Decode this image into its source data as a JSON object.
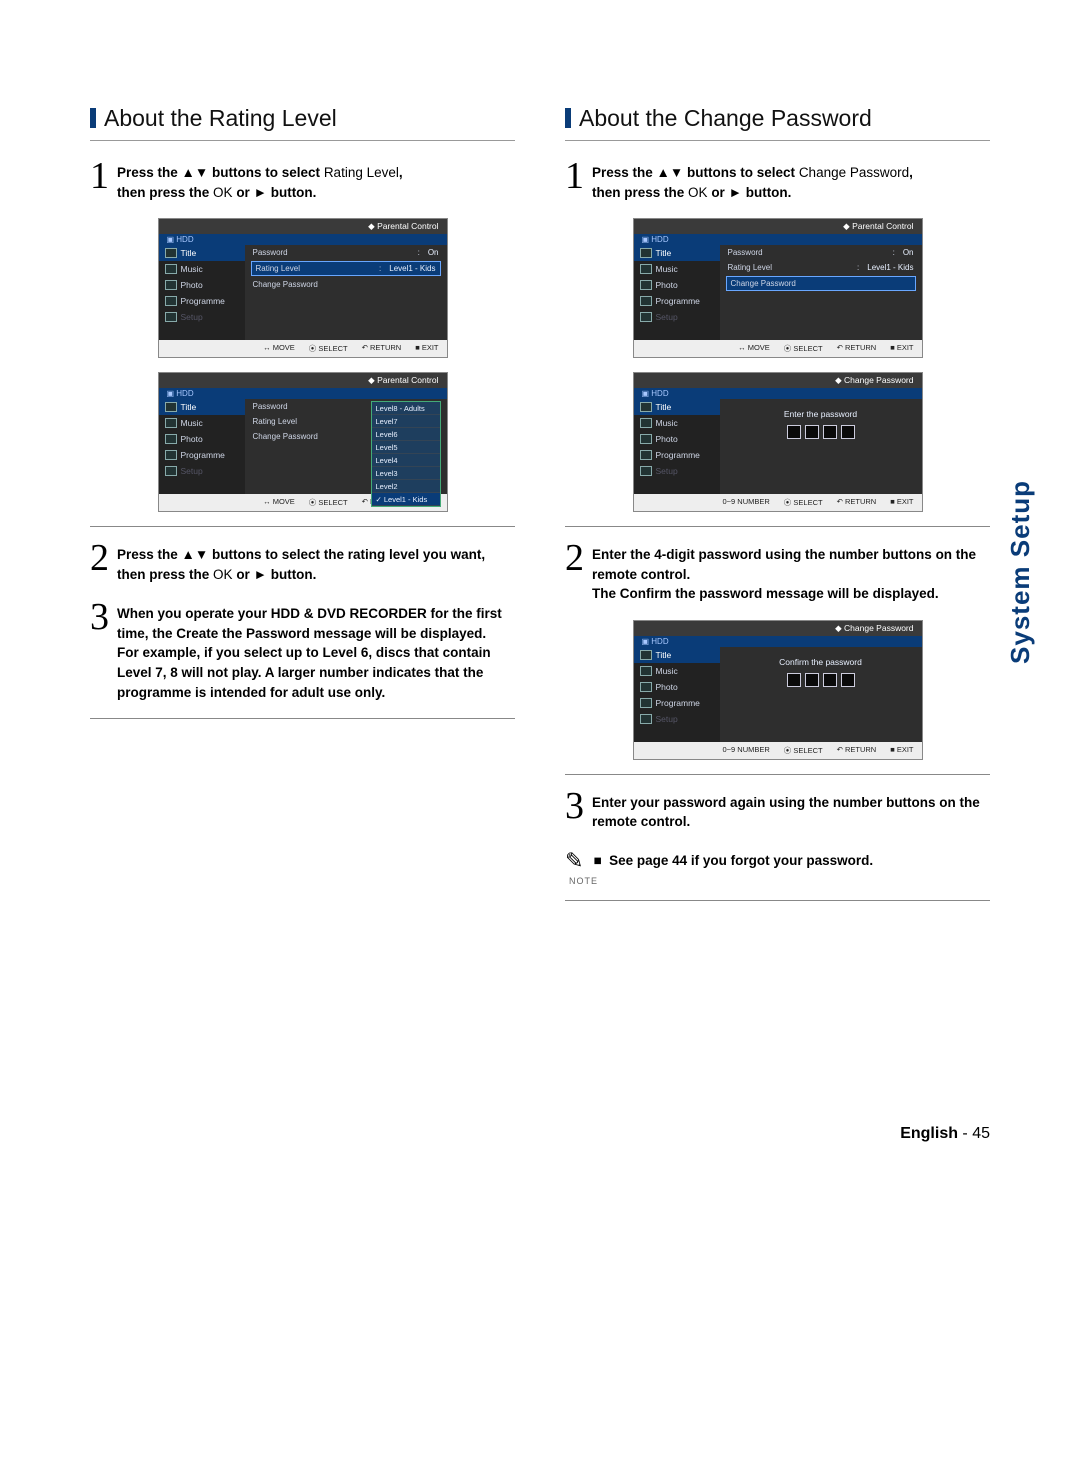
{
  "page": {
    "lang": "English",
    "num": "45",
    "vertical_label": "System Setup"
  },
  "left": {
    "title": "About the Rating Level",
    "step1": {
      "num": "1",
      "t1": "Press the ",
      "t2": " buttons to select",
      "target": "Rating Level",
      "t3": ",",
      "t4": "then press the",
      "ok": "OK",
      "t5": " or ",
      "t6": " button."
    },
    "step2": {
      "num": "2",
      "t1": "Press the ",
      "t2": " buttons to select the rating level you want, then press the",
      "ok": "OK",
      "t3": " or ",
      "t4": " button."
    },
    "step3": {
      "num": "3",
      "body": "When you operate your HDD & DVD RECORDER for the first time, the Create the Password message will be displayed.\nFor example, if you select up to Level 6, discs that contain Level 7, 8 will not play. A larger number indicates that the programme is intended for adult use only."
    }
  },
  "right": {
    "title": "About the Change Password",
    "step1": {
      "num": "1",
      "t1": "Press the ",
      "t2": " buttons to select",
      "target": "Change Password",
      "t3": ",",
      "t4": "then press the",
      "ok": "OK",
      "t5": " or ",
      "t6": " button."
    },
    "step2": {
      "num": "2",
      "t1": "Enter the 4-digit",
      "t2": "password using the number buttons",
      "t3": "on the remote control.",
      "t4": "The Confirm the password message will be displayed."
    },
    "step3": {
      "num": "3",
      "t1": "Enter",
      "t2": "your password again using the number buttons on the",
      "t3": "remote control."
    },
    "note": "See page 44 if you forgot your password.",
    "note_label": "NOTE"
  },
  "osd": {
    "nav": [
      "Title",
      "Music",
      "Photo",
      "Programme",
      "Setup"
    ],
    "hdd": "HDD",
    "pc": "Parental Control",
    "cp": "Change Password",
    "rows": {
      "password": "Password",
      "on": "On",
      "rating": "Rating Level",
      "rl_val": "Level1 - Kids",
      "changepw": "Change Password"
    },
    "levels": [
      "Level8 - Adults",
      "Level7",
      "Level6",
      "Level5",
      "Level4",
      "Level3",
      "Level2",
      "Level1 - Kids"
    ],
    "enter": "Enter the password",
    "confirm": "Confirm the password",
    "foot": {
      "move": "MOVE",
      "num": "0~9 NUMBER",
      "select": "SELECT",
      "return": "RETURN",
      "exit": "EXIT"
    }
  }
}
